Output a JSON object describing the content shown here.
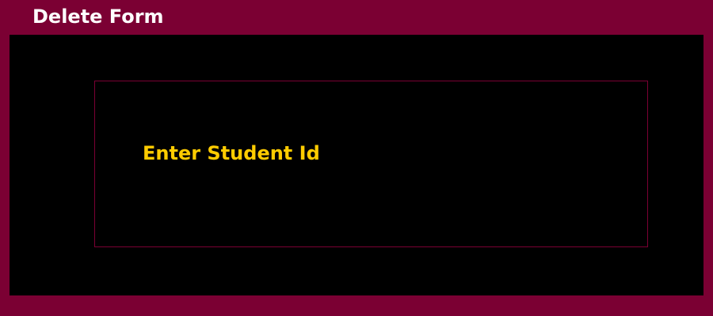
{
  "window": {
    "title": "Delete Form"
  },
  "form": {
    "student_id_label": "Enter Student Id"
  },
  "colors": {
    "frame": "#7b0033",
    "content_background": "#000000",
    "title_text": "#ffffff",
    "label_text": "#ffcc00",
    "panel_border": "#7b0033"
  }
}
